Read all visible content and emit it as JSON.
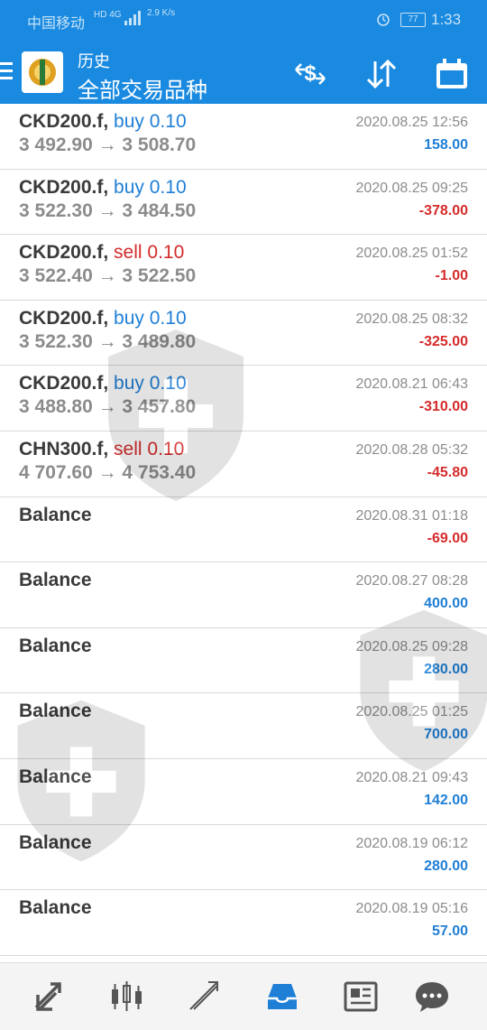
{
  "status_bar": {
    "carrier": "中国移动",
    "network": "HD 4G",
    "speed": "2.9 K/s",
    "battery": "77",
    "time": "1:33"
  },
  "header": {
    "title": "历史",
    "subtitle": "全部交易品种",
    "icons": [
      "menu-icon",
      "app-logo",
      "currency-sort-icon",
      "sort-icon",
      "calendar-icon"
    ],
    "color": "#1a8ae0"
  },
  "trades": [
    {
      "symbol": "CKD200.f,",
      "side": "buy",
      "volume": "0.10",
      "prices": "3 492.90 → 3 508.70",
      "time": "2020.08.25 12:56",
      "profit": "158.00",
      "positive": true
    },
    {
      "symbol": "CKD200.f,",
      "side": "buy",
      "volume": "0.10",
      "prices": "3 522.30 → 3 484.50",
      "time": "2020.08.25 09:25",
      "profit": "-378.00",
      "positive": false
    },
    {
      "symbol": "CKD200.f,",
      "side": "sell",
      "volume": "0.10",
      "prices": "3 522.40 → 3 522.50",
      "time": "2020.08.25 01:52",
      "profit": "-1.00",
      "positive": false
    },
    {
      "symbol": "CKD200.f,",
      "side": "buy",
      "volume": "0.10",
      "prices": "3 522.30 → 3 489.80",
      "time": "2020.08.25 08:32",
      "profit": "-325.00",
      "positive": false
    },
    {
      "symbol": "CKD200.f,",
      "side": "buy",
      "volume": "0.10",
      "prices": "3 488.80 → 3 457.80",
      "time": "2020.08.21 06:43",
      "profit": "-310.00",
      "positive": false
    },
    {
      "symbol": "CHN300.f,",
      "side": "sell",
      "volume": "0.10",
      "prices": "4 707.60 → 4 753.40",
      "time": "2020.08.28 05:32",
      "profit": "-45.80",
      "positive": false
    }
  ],
  "balances": [
    {
      "label": "Balance",
      "time": "2020.08.31 01:18",
      "amount": "-69.00",
      "positive": false
    },
    {
      "label": "Balance",
      "time": "2020.08.27 08:28",
      "amount": "400.00",
      "positive": true
    },
    {
      "label": "Balance",
      "time": "2020.08.25 09:28",
      "amount": "280.00",
      "positive": true
    },
    {
      "label": "Balance",
      "time": "2020.08.25 01:25",
      "amount": "700.00",
      "positive": true
    },
    {
      "label": "Balance",
      "time": "2020.08.21 09:43",
      "amount": "142.00",
      "positive": true
    },
    {
      "label": "Balance",
      "time": "2020.08.19 06:12",
      "amount": "280.00",
      "positive": true
    },
    {
      "label": "Balance",
      "time": "2020.08.19 05:16",
      "amount": "57.00",
      "positive": true
    }
  ],
  "bottom_nav": [
    "quotes-icon",
    "chart-icon",
    "trade-icon",
    "history-icon",
    "news-icon",
    "chat-icon"
  ],
  "colors": {
    "buy": "#1f7fd6",
    "sell": "#d52b2b",
    "active_tab": "#1f7fd6"
  }
}
